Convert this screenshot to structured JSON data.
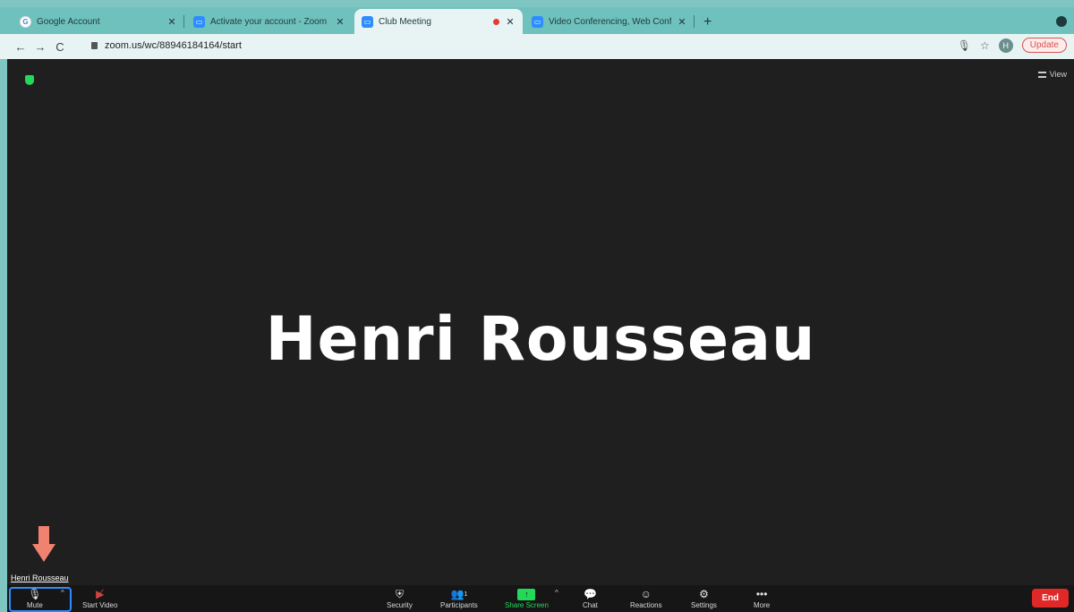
{
  "browser": {
    "tabs": [
      {
        "title": "Google Account",
        "icon": "google-icon"
      },
      {
        "title": "Activate your account - Zoom",
        "icon": "zoom-icon"
      },
      {
        "title": "Club Meeting",
        "icon": "zoom-icon",
        "active": true,
        "recording": true
      },
      {
        "title": "Video Conferencing, Web Conf",
        "icon": "zoom-icon"
      }
    ],
    "new_tab": "+",
    "url": "zoom.us/wc/88946184164/start",
    "profile_initial": "H",
    "update_label": "Update"
  },
  "meeting": {
    "view_label": "View",
    "participant_name": "Henri Rousseau",
    "self_label": "Henri Rousseau"
  },
  "controls": {
    "mute": "Mute",
    "start_video": "Start Video",
    "security": "Security",
    "participants": "Participants",
    "participants_count": "1",
    "share_screen": "Share Screen",
    "chat": "Chat",
    "reactions": "Reactions",
    "settings": "Settings",
    "more": "More",
    "end": "End"
  },
  "colors": {
    "accent": "#2d8cff",
    "share_green": "#23d959",
    "end_red": "#e02828",
    "browser_teal": "#6fc1bd"
  }
}
